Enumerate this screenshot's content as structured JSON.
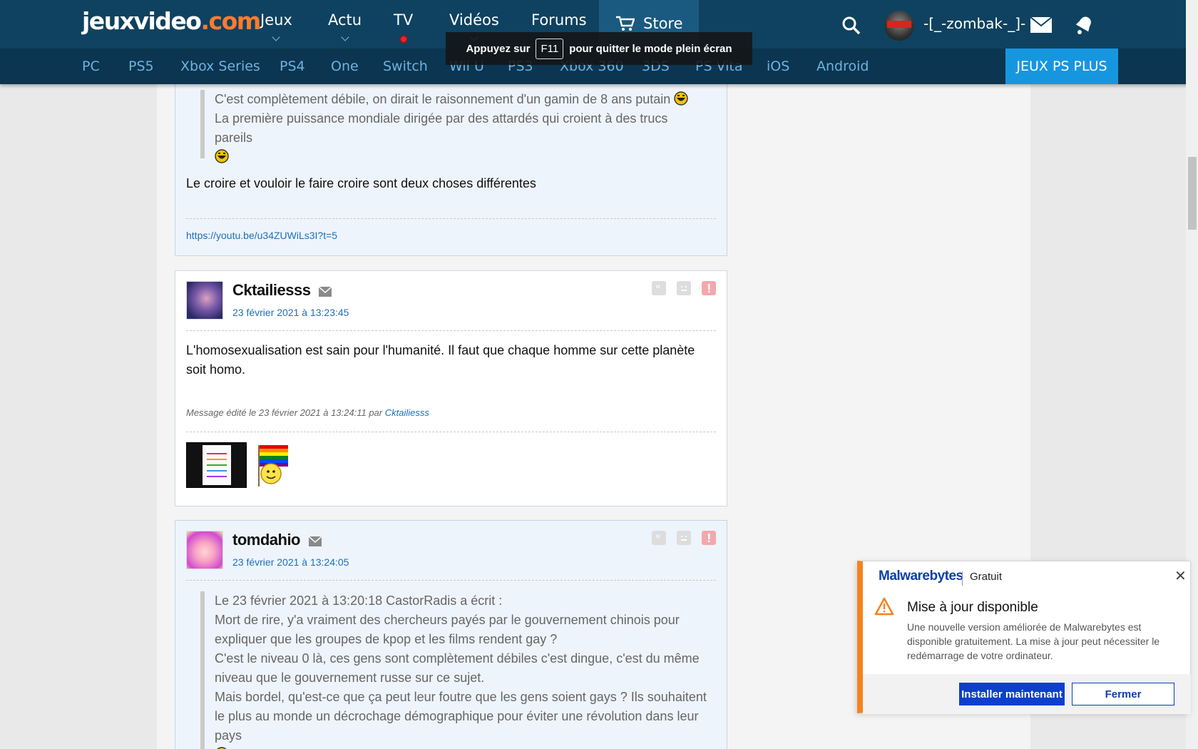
{
  "header": {
    "logo_main": "jeuxvideo",
    "logo_tld": ".com",
    "nav": [
      {
        "label": "Jeux"
      },
      {
        "label": "Actu"
      },
      {
        "label": "TV"
      },
      {
        "label": "Vidéos"
      },
      {
        "label": "Forums"
      }
    ],
    "store_label": "Store",
    "username": "-[_-zombak-_]-"
  },
  "platforms": [
    "PC",
    "PS5",
    "Xbox Series",
    "PS4",
    "One",
    "Switch",
    "Wii U",
    "PS3",
    "Xbox 360",
    "3DS",
    "PS Vita",
    "iOS",
    "Android"
  ],
  "promo_label": "JEUX PS PLUS",
  "fullscreen_notice": {
    "before": "Appuyez sur",
    "key": "F11",
    "after": "pour quitter le mode plein écran"
  },
  "posts": [
    {
      "quote_lines": [
        "C'est complètement débile, on dirait le raisonnement d'un gamin de 8 ans putain",
        "La première puissance mondiale dirigée par des attardés qui croient à des trucs pareils"
      ],
      "message": "Le croire et vouloir le faire croire sont deux choses différentes",
      "signature_link": "https://youtu.be/u34ZUWiLs3I?t=5"
    },
    {
      "author": "Cktailiesss",
      "date": "23 février 2021 à 13:23:45",
      "message": "L'homosexualisation est sain pour l'humanité. Il faut que chaque homme sur cette planète soit homo.",
      "edited_prefix": "Message édité le 23 février 2021 à 13:24:11 par",
      "edited_by": "Cktailiesss"
    },
    {
      "author": "tomdahio",
      "date": "23 février 2021 à 13:24:05",
      "quote_lines": [
        "Le 23 février 2021 à 13:20:18 CastorRadis a écrit :",
        "Mort de rire, y'a vraiment des chercheurs payés par le gouvernement chinois pour expliquer que les groupes de kpop et les films rendent gay ?",
        "C'est le niveau 0 là, ces gens sont complètement débiles c'est dingue, c'est du même niveau que le gouvernement russe sur ce sujet.",
        "Mais bordel, qu'est-ce que ça peut leur foutre que les gens soient gays ? Ils souhaitent le plus au monde un décrochage démographique pour éviter une révolution dans leur pays"
      ]
    }
  ],
  "malwarebytes": {
    "brand": "Malwarebytes",
    "tier": "Gratuit",
    "title": "Mise à jour disponible",
    "text": "Une nouvelle version améliorée de Malwarebytes est disponible gratuitement. La mise à jour peut nécessiter le redémarrage de votre ordinateur.",
    "install_label": "Installer maintenant",
    "close_label": "Fermer",
    "accent": "#f5821f"
  },
  "colors": {
    "topbar": "#0f4260",
    "subbar": "#0b3550",
    "platform_link": "#6fb2df",
    "promo": "#1796e0",
    "link": "#1c6fbd"
  }
}
